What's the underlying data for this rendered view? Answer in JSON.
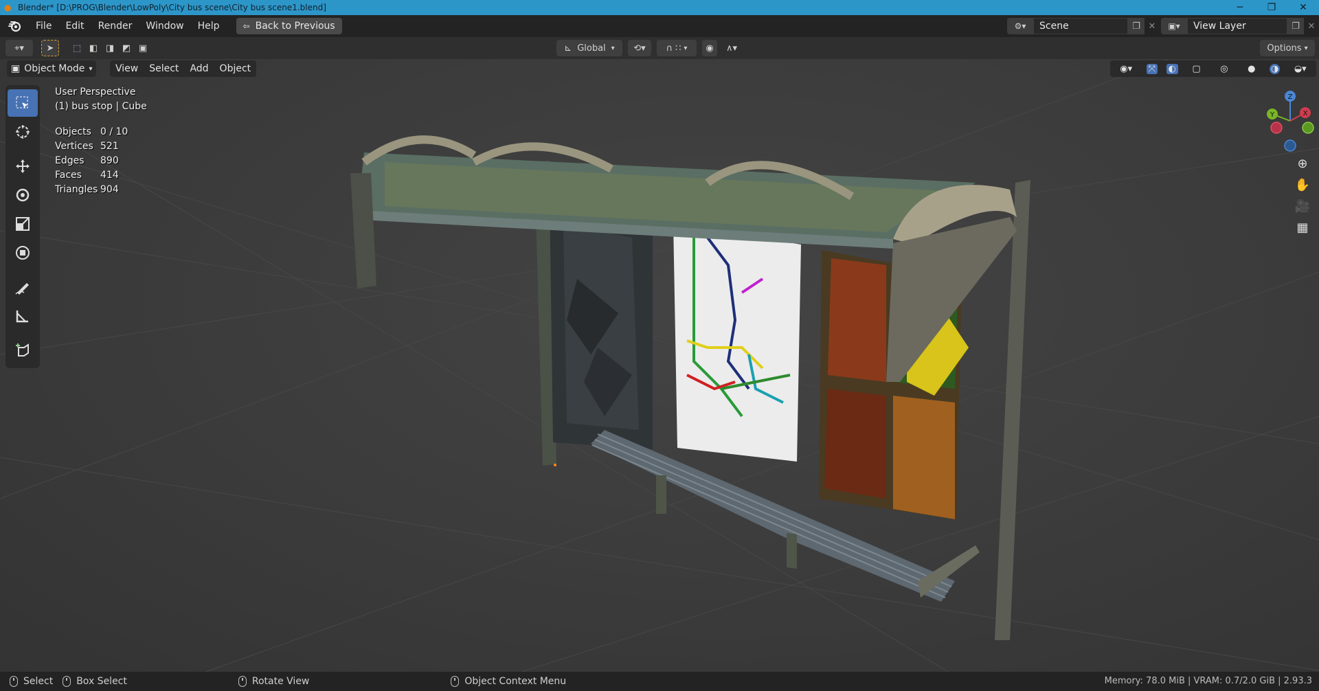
{
  "window": {
    "title": "Blender* [D:\\PROG\\Blender\\LowPoly\\City bus scene\\City bus scene1.blend]",
    "controls": {
      "minimize": "─",
      "maximize": "❐",
      "close": "✕"
    }
  },
  "menubar": {
    "items": [
      "File",
      "Edit",
      "Render",
      "Window",
      "Help"
    ],
    "back_button": "Back to Previous",
    "scene": "Scene",
    "view_layer": "View Layer"
  },
  "toolheader": {
    "orientation": "Global",
    "options": "Options"
  },
  "viewport_header": {
    "mode": "Object Mode",
    "menus": [
      "View",
      "Select",
      "Add",
      "Object"
    ]
  },
  "overlay": {
    "perspective": "User Perspective",
    "object": "(1) bus stop | Cube"
  },
  "stats": [
    {
      "label": "Objects",
      "value": "0 / 10"
    },
    {
      "label": "Vertices",
      "value": "521"
    },
    {
      "label": "Edges",
      "value": "890"
    },
    {
      "label": "Faces",
      "value": "414"
    },
    {
      "label": "Triangles",
      "value": "904"
    }
  ],
  "gizmo": {
    "z": "Z",
    "y": "Y",
    "x": "X"
  },
  "statusbar": {
    "select": "Select",
    "box_select": "Box Select",
    "rotate": "Rotate View",
    "context_menu": "Object Context Menu",
    "memory": "Memory: 78.0 MiB | VRAM: 0.7/2.0 GiB | 2.93.3"
  },
  "colors": {
    "accent": "#4772b3",
    "titlebar": "#2d96c9",
    "header": "#232323",
    "viewport": "#3a3a3a"
  }
}
